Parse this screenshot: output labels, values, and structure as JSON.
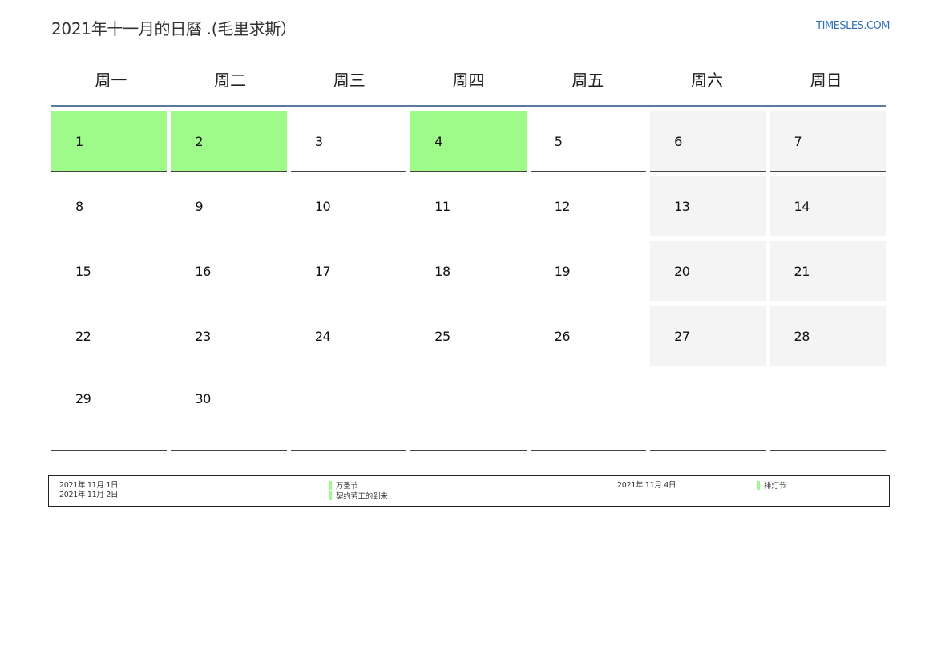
{
  "header": {
    "title": "2021年十一月的日曆 .(毛里求斯）",
    "brand": "TIMESLES.COM"
  },
  "weekdays": [
    "周一",
    "周二",
    "周三",
    "周四",
    "周五",
    "周六",
    "周日"
  ],
  "colors": {
    "holiday": "#9efb89",
    "weekend": "#f4f4f4",
    "header_rule": "#5b7a9e",
    "brand": "#2f6fb3"
  },
  "weeks": [
    [
      "1",
      "2",
      "3",
      "4",
      "5",
      "6",
      "7"
    ],
    [
      "8",
      "9",
      "10",
      "11",
      "12",
      "13",
      "14"
    ],
    [
      "15",
      "16",
      "17",
      "18",
      "19",
      "20",
      "21"
    ],
    [
      "22",
      "23",
      "24",
      "25",
      "26",
      "27",
      "28"
    ],
    [
      "29",
      "30",
      "",
      "",
      "",
      "",
      ""
    ]
  ],
  "legend": {
    "date_a1": "2021年 11月 1日",
    "date_a2": "2021年 11月 2日",
    "holiday_a1": "万圣节",
    "holiday_a2": "契约劳工的到来",
    "date_b1": "2021年 11月 4日",
    "holiday_b1": "排灯节"
  }
}
